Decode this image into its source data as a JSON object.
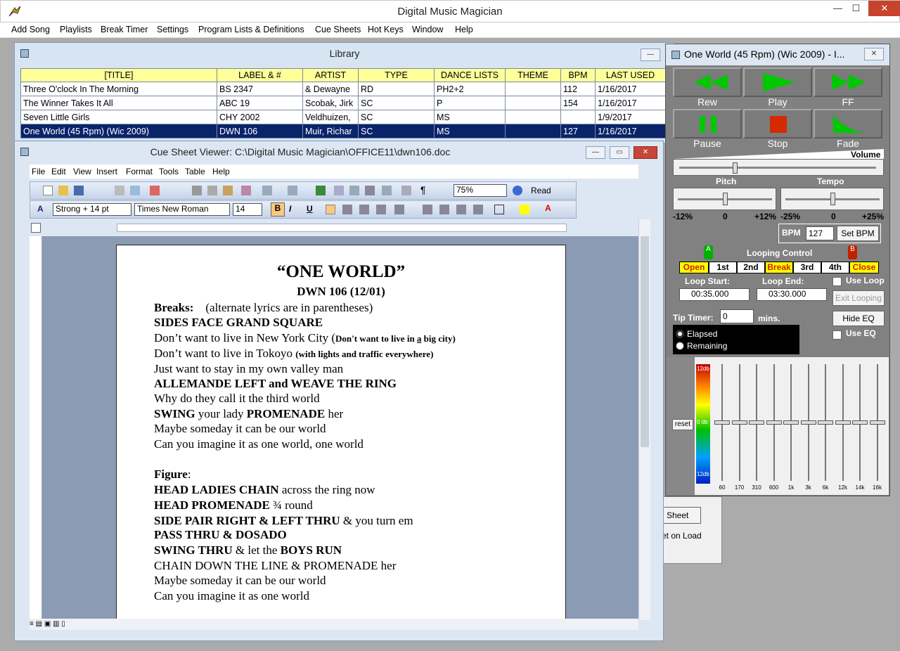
{
  "app": {
    "title": "Digital Music Magician",
    "caption_buttons": [
      "—",
      "☐",
      "✕"
    ]
  },
  "menu": [
    "Add Song",
    "Playlists",
    "Break Timer",
    "Settings",
    "Program Lists & Definitions",
    "Cue Sheets",
    "Hot Keys",
    "Window",
    "Help"
  ],
  "library": {
    "title": "Library",
    "columns": [
      "[TITLE]",
      "LABEL & #",
      "ARTIST",
      "TYPE",
      "DANCE LISTS",
      "THEME",
      "BPM",
      "LAST USED"
    ],
    "rows": [
      [
        "Three O'clock In The Morning",
        "BS 2347",
        "& Dewayne",
        "RD",
        "PH2+2",
        "",
        "112",
        "1/16/2017"
      ],
      [
        "The Winner Takes It All",
        "ABC 19",
        "Scobak, Jirk",
        "SC",
        "P",
        "",
        "154",
        "1/16/2017"
      ],
      [
        "Seven Little Girls",
        "CHY 2002",
        "Veldhuizen,",
        "SC",
        "MS",
        "",
        "",
        "1/9/2017"
      ],
      [
        "One World (45 Rpm) (Wic 2009)",
        "DWN 106",
        "Muir, Richar",
        "SC",
        "MS",
        "",
        "127",
        "1/16/2017"
      ]
    ]
  },
  "cue": {
    "title": "Cue Sheet Viewer: C:\\Digital Music Magician\\OFFICE11\\dwn106.doc",
    "menu": [
      "File",
      "Edit",
      "View",
      "Insert",
      "Format",
      "Tools",
      "Table",
      "Help"
    ],
    "zoom": "75%",
    "read_label": "Read",
    "style": "Strong + 14 pt",
    "font": "Times New Roman",
    "size": "14",
    "fmt": [
      "B",
      "I",
      "U"
    ]
  },
  "doc": {
    "title": "“ONE WORLD”",
    "subtitle": "DWN 106 (12/01)",
    "breaks_label": "Breaks:",
    "breaks_note": "(alternate lyrics are in parentheses)",
    "l1": "SIDES FACE GRAND SQUARE",
    "l2a": "Don’t want to live in New York City (",
    "l2b": "Don't want to live in ",
    "l2c": "a",
    "l2d": " big city)",
    "l3a": "Don’t want to live in Tokoyo ",
    "l3b": "(with lights and traffic everywhere)",
    "l4": "Just want to stay in my own valley man",
    "l5a": "ALLEMANDE LEFT ",
    "l5b": "and ",
    "l5c": "WEAVE THE RING",
    "l6": "Why do they call it the third world",
    "l7a": "SWING ",
    "l7b": "your lady ",
    "l7c": "PROMENADE ",
    "l7d": "her",
    "l8": "Maybe someday it can be our world",
    "l9": "Can you imagine it as one world, one world",
    "figure_label": "Figure",
    "f1a": "HEAD LADIES CHAIN ",
    "f1b": "across the ring now",
    "f2a": "HEAD PROMENADE ",
    "f2b": "¾ round",
    "f3a": "SIDE PAIR RIGHT & LEFT THRU ",
    "f3b": "& you turn em",
    "f4": "PASS THRU & DOSADO",
    "f5a": "SWING THRU ",
    "f5b": "& let the ",
    "f5c": "BOYS RUN",
    "f6": "CHAIN DOWN THE LINE & PROMENADE her",
    "f7": "Maybe someday it can be our world",
    "f8": "Can you imagine it as one world"
  },
  "player": {
    "title": "One World (45 Rpm) (Wic 2009) - I...",
    "buttons": [
      "Rew",
      "Play",
      "FF",
      "Pause",
      "Stop",
      "Fade"
    ],
    "volume_label": "Volume",
    "volume": 0.27,
    "pitch_label": "Pitch",
    "tempo_label": "Tempo",
    "pitch_ticks": [
      "-12%",
      "0",
      "+12%"
    ],
    "tempo_ticks": [
      "-25%",
      "0",
      "+25%"
    ],
    "bpm_label": "BPM",
    "bpm": "127",
    "set_bpm": "Set BPM",
    "loop_title": "Looping Control",
    "marker_a": "A",
    "marker_b": "B",
    "loop_buttons": [
      "Open",
      "1st",
      "2nd",
      "Break",
      "3rd",
      "4th",
      "Close"
    ],
    "loop_start_label": "Loop Start:",
    "loop_end_label": "Loop End:",
    "loop_start": "00:35.000",
    "loop_end": "03:30.000",
    "use_loop": "Use Loop",
    "exit_looping": "Exit Looping",
    "hide_eq": "Hide EQ",
    "use_eq": "Use EQ",
    "tip_timer": "Tip Timer:",
    "tip_value": "0",
    "mins": "mins.",
    "elapsed": "Elapsed",
    "remaining": "Remaining",
    "eq_reset": "reset",
    "eq_db": [
      "12db",
      "0 db",
      "12db"
    ],
    "eq_bands": [
      "60",
      "170",
      "310",
      "600",
      "1k",
      "3k",
      "6k",
      "12k",
      "14k",
      "16k"
    ]
  },
  "behind": {
    "sheet": "Sheet",
    "load": "et on Load"
  }
}
